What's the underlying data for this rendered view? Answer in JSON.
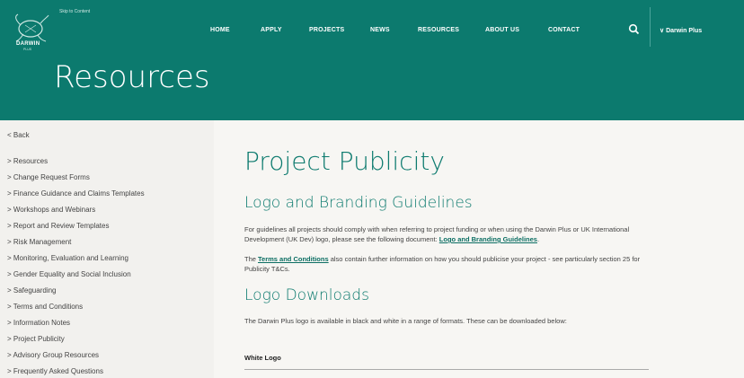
{
  "header": {
    "skip_link": "Skip to Content",
    "logo_text": "DARWIN",
    "logo_sub": "PLUS",
    "nav": [
      "HOME",
      "APPLY",
      "PROJECTS",
      "NEWS",
      "RESOURCES",
      "ABOUT US",
      "CONTACT"
    ],
    "language": "∨ Darwin Plus",
    "banner_title": "Resources"
  },
  "sidebar": {
    "back": "< Back",
    "items": [
      "> Resources",
      "> Change Request Forms",
      "> Finance Guidance and Claims Templates",
      "> Workshops and Webinars",
      "> Report and Review Templates",
      "> Risk Management",
      "> Monitoring, Evaluation and Learning",
      "> Gender Equality and Social Inclusion",
      "> Safeguarding",
      "> Terms and Conditions",
      "> Information Notes",
      "> Project Publicity",
      "> Advisory Group Resources",
      "> Frequently Asked Questions"
    ]
  },
  "main": {
    "title": "Project Publicity",
    "section1_heading": "Logo and Branding Guidelines",
    "section1_text_a": "For guidelines all projects should comply with when referring to project funding or when using the Darwin Plus or UK International Development (UK Dev) logo, please see the following document: ",
    "section1_link": "Logo and Branding Guidelines",
    "section1_text_b": ".",
    "section1_text2_a": "The ",
    "section1_link2": "Terms and Conditions",
    "section1_text2_b": " also contain further information on how you should publicise your project - see particularly section 25 for Publicity T&Cs.",
    "section2_heading": "Logo Downloads",
    "section2_text": "The Darwin Plus logo is available in black and white in a range of formats. These can be downloaded below:",
    "white_logo_label": "White Logo"
  },
  "colors": {
    "brand": "#0c7a6e",
    "background": "#f2f1ee"
  }
}
